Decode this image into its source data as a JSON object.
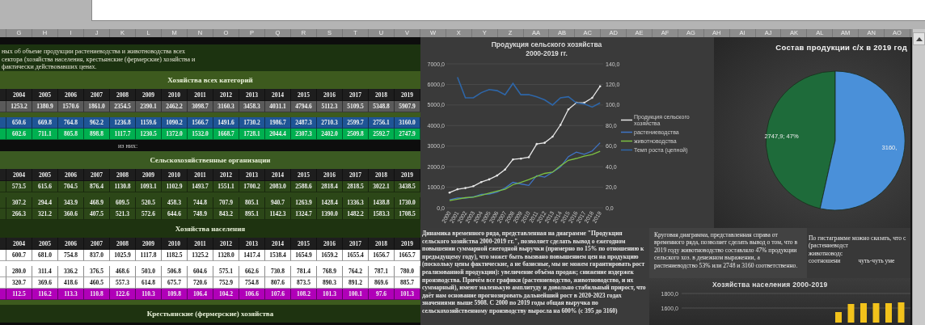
{
  "column_headers": {
    "left": [
      "G",
      "H",
      "I",
      "J",
      "K",
      "L",
      "M",
      "N",
      "O",
      "P",
      "Q",
      "R",
      "S",
      "T",
      "U",
      "V"
    ],
    "right": [
      "W",
      "X",
      "Y",
      "Z",
      "AA",
      "AB",
      "AC",
      "AD",
      "AE",
      "AF",
      "AG",
      "AH",
      "AI",
      "AJ",
      "AK",
      "AL",
      "AM",
      "AN",
      "AO"
    ]
  },
  "sheet": {
    "intro_lines": [
      "ных об объеме продукции растениеводства и животноводства всех",
      "сектора (хозяйства населения, крестьянские (фермерские) хозяйства и",
      "фактически действовавших ценах."
    ],
    "sections": [
      {
        "title": "Хозяйства всех категорий",
        "color": "#3d5a1e",
        "years": [
          "2004",
          "2005",
          "2006",
          "2007",
          "2008",
          "2009",
          "2010",
          "2011",
          "2012",
          "2013",
          "2014",
          "2015",
          "2016",
          "2017",
          "2018",
          "2019"
        ],
        "rows": [
          {
            "color": "#5a5a5a",
            "values": [
              "1253.2",
              "1380.9",
              "1570.6",
              "1861.0",
              "2354.5",
              "2390.1",
              "2462.2",
              "3098.7",
              "3160.3",
              "3458.3",
              "4031.1",
              "4794.6",
              "5112.3",
              "5109.5",
              "5348.8",
              "5907.9"
            ]
          },
          {
            "color": "#3d5a1e"
          },
          {
            "color": "#1f5596",
            "values": [
              "650.6",
              "669.8",
              "764.8",
              "962.2",
              "1236.8",
              "1159.6",
              "1090.2",
              "1566.7",
              "1491.6",
              "1730.2",
              "1986.7",
              "2487.3",
              "2710.3",
              "2599.7",
              "2756.1",
              "3160.0"
            ]
          },
          {
            "color": "#00b050",
            "values": [
              "602.6",
              "711.1",
              "805.8",
              "898.8",
              "1117.7",
              "1230.5",
              "1372.0",
              "1532.0",
              "1668.7",
              "1728.1",
              "2044.4",
              "2307.3",
              "2402.0",
              "2509.8",
              "2592.7",
              "2747.9"
            ]
          }
        ],
        "note": "из них:"
      },
      {
        "title": "Сельскохозяйственные организации",
        "color": "#3b5a22",
        "years": [
          "2004",
          "2005",
          "2006",
          "2007",
          "2008",
          "2009",
          "2010",
          "2011",
          "2012",
          "2013",
          "2014",
          "2015",
          "2016",
          "2017",
          "2018",
          "2019"
        ],
        "rows": [
          {
            "color": "#2c4718",
            "values": [
              "573.5",
              "615.6",
              "704.5",
              "876.4",
              "1130.8",
              "1093.1",
              "1102.9",
              "1493.7",
              "1551.1",
              "1700.2",
              "2083.0",
              "2588.6",
              "2818.4",
              "2818.5",
              "3022.1",
              "3438.5"
            ]
          },
          {
            "color": "#2c4718"
          },
          {
            "color": "#2c4718",
            "values": [
              "307.2",
              "294.4",
              "343.9",
              "468.9",
              "609.5",
              "520.5",
              "458.3",
              "744.8",
              "707.9",
              "805.1",
              "940.7",
              "1263.9",
              "1428.4",
              "1336.3",
              "1438.8",
              "1730.0"
            ]
          },
          {
            "color": "#2c4718",
            "values": [
              "266.3",
              "321.2",
              "360.6",
              "407.5",
              "521.3",
              "572.6",
              "644.6",
              "748.9",
              "843.2",
              "895.1",
              "1142.3",
              "1324.7",
              "1390.0",
              "1482.2",
              "1583.3",
              "1708.5"
            ]
          }
        ]
      },
      {
        "title": "Хозяйства населения",
        "color": "#1e3310",
        "years": [
          "2004",
          "2005",
          "2006",
          "2007",
          "2008",
          "2009",
          "2010",
          "2011",
          "2012",
          "2013",
          "2014",
          "2015",
          "2016",
          "2017",
          "2018",
          "2019"
        ],
        "rows": [
          {
            "color": "#ffffff",
            "values": [
              "600.7",
              "681.0",
              "754.8",
              "837.0",
              "1025.9",
              "1117.8",
              "1182.5",
              "1325.2",
              "1328.0",
              "1417.4",
              "1538.4",
              "1654.9",
              "1659.2",
              "1655.4",
              "1656.7",
              "1665.7"
            ]
          },
          {
            "color": "#ffffff"
          },
          {
            "color": "#ffffff",
            "values": [
              "280.0",
              "311.4",
              "336.2",
              "376.5",
              "468.6",
              "503.0",
              "506.8",
              "604.6",
              "575.1",
              "662.6",
              "730.8",
              "781.4",
              "768.9",
              "764.2",
              "787.1",
              "780.0"
            ]
          },
          {
            "color": "#ffffff",
            "values": [
              "320.7",
              "369.6",
              "418.6",
              "460.5",
              "557.3",
              "614.8",
              "675.7",
              "720.6",
              "752.9",
              "754.8",
              "807.6",
              "873.5",
              "890.3",
              "891.2",
              "869.6",
              "885.7"
            ]
          },
          {
            "color": "#b000b8",
            "values": [
              "112.5",
              "116.2",
              "113.3",
              "110.8",
              "122.6",
              "110.3",
              "109.8",
              "106.4",
              "104.2",
              "106.6",
              "107.6",
              "108.2",
              "101.3",
              "100.1",
              "97.6",
              "101.3"
            ]
          },
          {
            "color": "#3d5a1e"
          }
        ]
      },
      {
        "title": "Крестьянские (фермерские) хозяйства",
        "color": "#1e3310"
      }
    ]
  },
  "line_chart": {
    "chart_data": {
      "type": "line",
      "title": "Продукция сельского хозяйства 2000-2019 гг.",
      "ylim": [
        0,
        7000
      ],
      "y2lim": [
        0,
        140
      ],
      "grid": true,
      "legend": true,
      "categories": [
        "2000",
        "2001",
        "2002",
        "2003",
        "2004",
        "2005",
        "2006",
        "2007",
        "2008",
        "2009",
        "2010",
        "2011",
        "2012",
        "2013",
        "2014",
        "2015",
        "2016",
        "2017",
        "2018",
        "2019"
      ],
      "yticks": [
        {
          "value": 0,
          "label": "0,0"
        },
        {
          "value": 1000,
          "label": "1000,0"
        },
        {
          "value": 2000,
          "label": "2000,0"
        },
        {
          "value": 3000,
          "label": "3000,0"
        },
        {
          "value": 4000,
          "label": "4000,0"
        },
        {
          "value": 5000,
          "label": "5000,0"
        },
        {
          "value": 6000,
          "label": "6000,0"
        },
        {
          "value": 7000,
          "label": "7000,0"
        }
      ],
      "y2ticks": [
        {
          "value": 0,
          "label": "0,0"
        },
        {
          "value": 20,
          "label": "20,0"
        },
        {
          "value": 40,
          "label": "40,0"
        },
        {
          "value": 60,
          "label": "60,0"
        },
        {
          "value": 80,
          "label": "80,0"
        },
        {
          "value": 100,
          "label": "100,0"
        },
        {
          "value": 120,
          "label": "120,0"
        },
        {
          "value": 140,
          "label": "140,0"
        }
      ],
      "series": [
        {
          "name": "Продукция сельского хозяйства",
          "color": "#e6e6e6",
          "values": [
            740,
            900,
            960,
            1050,
            1250,
            1380,
            1570,
            1860,
            2350,
            2390,
            2460,
            3100,
            3160,
            3460,
            4030,
            4790,
            5110,
            5110,
            5350,
            5910
          ]
        },
        {
          "name": "растениеводства",
          "color": "#3f74c6",
          "values": [
            390,
            480,
            470,
            530,
            650,
            670,
            760,
            960,
            1240,
            1160,
            1090,
            1570,
            1490,
            1730,
            1990,
            2490,
            2710,
            2600,
            2760,
            3160
          ]
        },
        {
          "name": "животноводства",
          "color": "#7cc043",
          "values": [
            350,
            420,
            490,
            520,
            600,
            710,
            810,
            900,
            1120,
            1230,
            1370,
            1530,
            1670,
            1730,
            2040,
            2310,
            2400,
            2510,
            2590,
            2750
          ]
        },
        {
          "name": "Темп роста (цепной)",
          "color": "#2e66a8",
          "axis": "y2",
          "values": [
            null,
            127,
            107,
            107,
            112,
            115,
            114,
            110,
            121,
            110,
            110,
            108,
            105,
            100,
            107,
            108,
            102,
            101,
            98,
            102
          ]
        }
      ]
    }
  },
  "pie_chart": {
    "chart_data": {
      "type": "pie",
      "title": "Состав продукции с/х в 2019 год",
      "values": [
        2747.9,
        3160.0
      ],
      "colors": [
        "#1e6b3a",
        "#4a90d9"
      ],
      "value_labels": [
        "2747,9; 47%",
        "3160,"
      ]
    }
  },
  "notes": [
    {
      "text": "Динамика временного ряда, представленная на диаграмме \"Продукция сельского хозяйства 2000-2019 гг.\", позволяет сделать вывод о ежегодном повышении суммарной ежегодной выручки (примерно по 15% по отношению к предыдущему году), что может быть вызвано повышением цен на продукцию (поскольку цены фактические, а не базисные, мы не можем гарантировать рост реализованной продукции): увеличение объёма продаж; снижение издержек производства. Причём все графики (растениеводство, животноводство, и их суммарный), имеют маленькую амплитуду и довольно стабильный прирост, что даёт нам основание прогнозировать дальнейший рост в 2020-2023 годах значениями выше 5908. С 2000 по 2019 годы общая выручка по сельскохозяйственному производству выросла на 600% (с 395 до 3160)"
    },
    {
      "text": "Круговая диаграмма, представленная справа от временного ряда, позволяет сделать вывод о том, что в 2019 году животноводство составляло 47% продукции сельского хоз. в денежном выражении, а растениеводство 53% или 2748 и 3160 соответственно."
    },
    {
      "lines": [
        [
          "По гистаграмме можно сказать, что с"
        ],
        [
          "(растениеводст"
        ],
        [
          "животноводс"
        ],
        [
          "соотношени",
          "чуть-чуть уме"
        ]
      ]
    }
  ],
  "bar_chart": {
    "title": "Хозяйства населения 2000-2019",
    "tick_labels": [
      "1800,0",
      "1600,0"
    ]
  }
}
